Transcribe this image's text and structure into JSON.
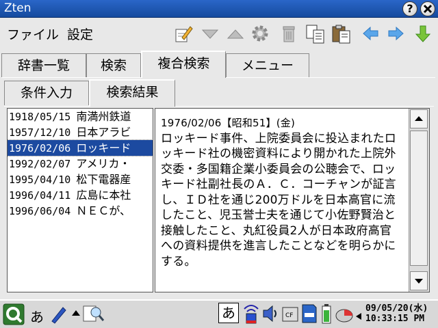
{
  "window": {
    "title": "Zten",
    "help_symbol": "?",
    "close_symbol": "✕"
  },
  "menu": {
    "file": "ファイル",
    "settings": "設定"
  },
  "toolbar_icons": [
    "edit-icon",
    "triangle-down-icon",
    "triangle-up-icon",
    "gear-icon",
    "trash-icon",
    "copy-icon",
    "paste-icon",
    "back-arrow-icon",
    "forward-arrow-icon",
    "down-arrow-icon"
  ],
  "tabs_main": [
    "辞書一覧",
    "検索",
    "複合検索",
    "メニュー"
  ],
  "tabs_main_active": "複合検索",
  "tabs_sub": [
    "条件入力",
    "検索結果"
  ],
  "tabs_sub_active": "検索結果",
  "results": [
    {
      "date": "1918/05/15",
      "text": "南満州鉄道"
    },
    {
      "date": "1957/12/10",
      "text": "日本アラビ"
    },
    {
      "date": "1976/02/06",
      "text": "ロッキード"
    },
    {
      "date": "1992/02/07",
      "text": "アメリカ・"
    },
    {
      "date": "1995/04/10",
      "text": "松下電器産"
    },
    {
      "date": "1996/04/11",
      "text": "広島に本社"
    },
    {
      "date": "1996/06/04",
      "text": "ＮＥＣが、"
    }
  ],
  "selected_index": 2,
  "article": {
    "heading": "1976/02/06【昭和51】(金)",
    "body": "ロッキード事件、上院委員会に投込まれたロッキード社の機密資料により開かれた上院外交委・多国籍企業小委員会の公聴会で、ロッキード社副社長のＡ．Ｃ．コーチャンが証言し、ＩＤ社を通じ200万ドルを日本高官に流したこと、児玉誉士夫を通じて小佐野賢治と接触したこと、丸紅役員2人が日本政府高官への資料提供を進言したことなどを明らかにする。"
  },
  "taskbar": {
    "ime_char": "あ",
    "ime_box_char": "あ",
    "date": "09/05/20(水)",
    "time": "10:33:15 PM"
  },
  "colors": {
    "titlebar": "#1f5bbd",
    "selection": "#1c4aa0",
    "arrow_blue": "#3f8fe0",
    "arrow_green": "#3da23d"
  }
}
